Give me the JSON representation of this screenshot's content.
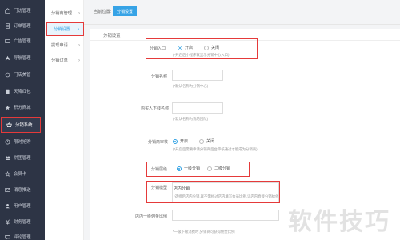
{
  "sidebar": {
    "items": [
      {
        "label": "门访管理",
        "icon": "shop-icon"
      },
      {
        "label": "订单管理",
        "icon": "order-icon"
      },
      {
        "label": "广告管理",
        "icon": "ad-icon"
      },
      {
        "label": "导航管理",
        "icon": "navigation-icon"
      },
      {
        "label": "门店美管",
        "icon": "store-icon"
      },
      {
        "label": "天降红包",
        "icon": "red-packet-icon"
      },
      {
        "label": "积分商城",
        "icon": "points-mall-icon"
      },
      {
        "label": "分销系统",
        "icon": "distribution-icon"
      },
      {
        "label": "限时抢购",
        "icon": "clock-icon"
      },
      {
        "label": "拼团管理",
        "icon": "group-buy-icon"
      },
      {
        "label": "会员卡",
        "icon": "member-card-icon"
      },
      {
        "label": "消息推送",
        "icon": "message-icon"
      },
      {
        "label": "用户管理",
        "icon": "user-icon"
      },
      {
        "label": "财务管理",
        "icon": "finance-icon"
      },
      {
        "label": "评论管理",
        "icon": "comment-icon"
      }
    ]
  },
  "subnav": {
    "items": [
      {
        "label": "分销商管理"
      },
      {
        "label": "分销设置"
      },
      {
        "label": "提现申请"
      },
      {
        "label": "分销订单"
      }
    ]
  },
  "topbar": {
    "crumb_label": "当前位置:",
    "crumb_tag": "分销设置"
  },
  "panel": {
    "title": "分销设置",
    "entry": {
      "label": "分销入口",
      "opt_on": "开启",
      "opt_off": "关闭",
      "hint": "(*开启后小程序就显示分销中心入口)"
    },
    "name": {
      "label": "分销名称",
      "hint": "(*默认名称为分销中心)"
    },
    "lower": {
      "label": "购买人下线名称",
      "hint": "(*默认名称为我的团队)"
    },
    "review": {
      "label": "分销商审核",
      "opt_on": "开启",
      "opt_off": "关闭",
      "hint": "(*开启后需要申请分销商后台审核通过才能成为分销商)"
    },
    "level": {
      "label": "分销层级",
      "opt_one": "一级分销",
      "opt_two": "二级分销"
    },
    "mode": {
      "label": "分销模型",
      "value": "店内分销",
      "hint": "*选择后店内分销,就不需经过店内填写会员比例,让店内直接分销给他们的收益"
    },
    "commission": {
      "label": "店内一级佣金比例",
      "hint": "*一级下级消费时,分销商可获得佣金比例"
    }
  },
  "watermark": "软件技巧"
}
